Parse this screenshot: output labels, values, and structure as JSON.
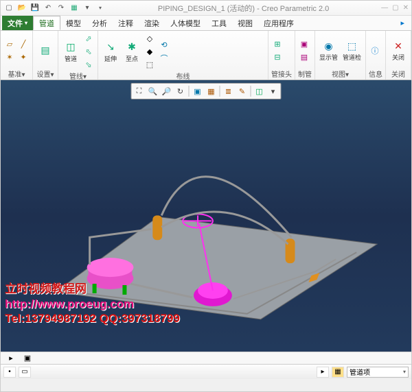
{
  "titlebar": {
    "title": "PIPING_DESIGN_1 (活动的) - Creo Parametric 2.0"
  },
  "menu": {
    "file": "文件",
    "items": [
      "管道",
      "模型",
      "分析",
      "注释",
      "渲染",
      "人体模型",
      "工具",
      "视图",
      "应用程序"
    ],
    "active_index": 0
  },
  "ribbon": {
    "groups": [
      {
        "label": "基准▾",
        "items": []
      },
      {
        "label": "设置▾",
        "items": [
          "管道"
        ]
      },
      {
        "label": "管线▾",
        "items": [
          "延伸",
          "至点"
        ]
      },
      {
        "label": "布线",
        "items": []
      },
      {
        "label": "管接头",
        "items": []
      },
      {
        "label": "制管",
        "items": []
      },
      {
        "label": "视图▾",
        "items": [
          "显示管",
          "管道检"
        ]
      },
      {
        "label": "信息",
        "items": []
      },
      {
        "label": "关闭",
        "items": [
          "关闭"
        ]
      }
    ]
  },
  "sub_ribbon": [
    "基准▾",
    "设置▾",
    "管线▾",
    "布线",
    "管接头",
    "制管",
    "视图▾",
    "信息",
    "关闭"
  ],
  "view_toolbar_icons": [
    "zoom-fit",
    "zoom-in",
    "zoom-out",
    "refit",
    "sep",
    "display-style",
    "saved-views",
    "sep",
    "layers",
    "annotations",
    "sep",
    "transparency",
    "sep",
    "more"
  ],
  "watermark": {
    "line1": "立时视频教程网",
    "line2": "http://www.proeug.com",
    "line3": "Tel:13794987192    QQ:397318799"
  },
  "statusbar": {
    "combo": "管道项"
  }
}
